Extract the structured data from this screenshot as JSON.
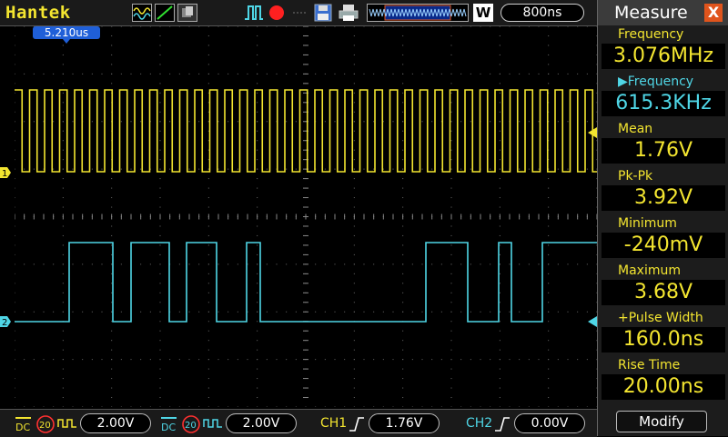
{
  "header": {
    "brand": "Hantek",
    "timebase": "800ns",
    "wave_badge": "W",
    "trigger_pos": "5.210us"
  },
  "icons": [
    "waveform-mode-icon",
    "dot-mode-icon",
    "persistence-icon",
    "run-mode-icon",
    "record-icon",
    "save-icon",
    "print-icon",
    "memory-depth-icon"
  ],
  "colors": {
    "ch1": "#f3e530",
    "ch2": "#4fd6e6",
    "panel_value": "#f3e530"
  },
  "channels": [
    {
      "name": "1",
      "volts_div": "2.00V",
      "coupling": "DC",
      "bw_limit": "20"
    },
    {
      "name": "2",
      "volts_div": "2.00V",
      "coupling": "DC",
      "bw_limit": "20"
    }
  ],
  "trigger": [
    {
      "label": "CH1",
      "level": "1.76V"
    },
    {
      "label": "CH2",
      "level": "0.00V"
    }
  ],
  "measure": {
    "title": "Measure",
    "close": "X",
    "modify": "Modify",
    "items": [
      {
        "label": "Frequency",
        "value": "3.076MHz",
        "ch": 1
      },
      {
        "label": "▶Frequency",
        "value": "615.3KHz",
        "ch": 2
      },
      {
        "label": "Mean",
        "value": "1.76V",
        "ch": 1
      },
      {
        "label": "Pk-Pk",
        "value": "3.92V",
        "ch": 1
      },
      {
        "label": "Minimum",
        "value": "-240mV",
        "ch": 1
      },
      {
        "label": "Maximum",
        "value": "3.68V",
        "ch": 1
      },
      {
        "label": "+Pulse Width",
        "value": "160.0ns",
        "ch": 1
      },
      {
        "label": "Rise Time",
        "value": "20.00ns",
        "ch": 1
      }
    ]
  }
}
